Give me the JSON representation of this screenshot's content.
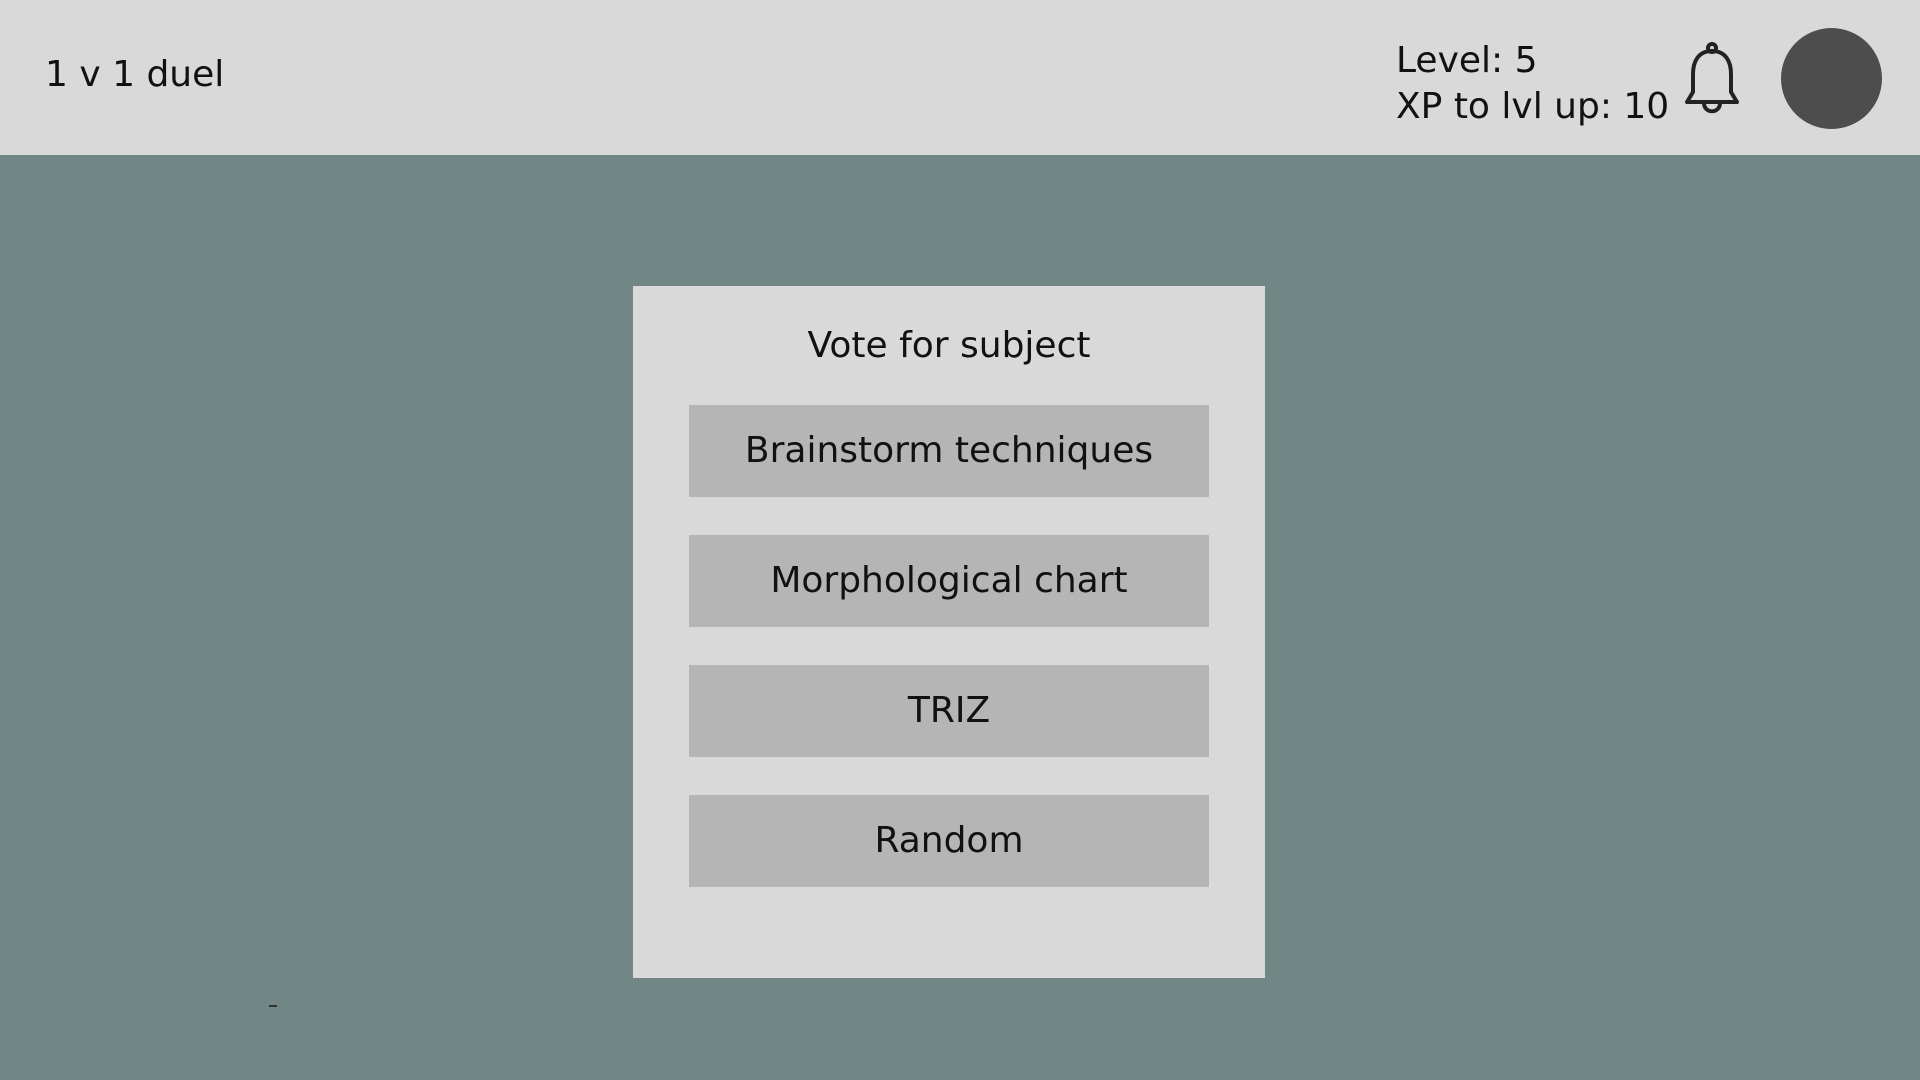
{
  "header": {
    "title": "1 v 1 duel",
    "level_label": "Level: 5",
    "xp_label": "XP to lvl up: 10",
    "notification_icon": "bell-icon",
    "avatar_color": "#4d4d4d"
  },
  "vote": {
    "title": "Vote for subject",
    "options": [
      {
        "label": "Brainstorm techniques"
      },
      {
        "label": "Morphological chart"
      },
      {
        "label": "TRIZ"
      },
      {
        "label": "Random"
      }
    ]
  },
  "colors": {
    "background": "#718785",
    "topbar": "#d9d9d9",
    "panel": "#d9d9d9",
    "button": "#b5b5b5"
  }
}
